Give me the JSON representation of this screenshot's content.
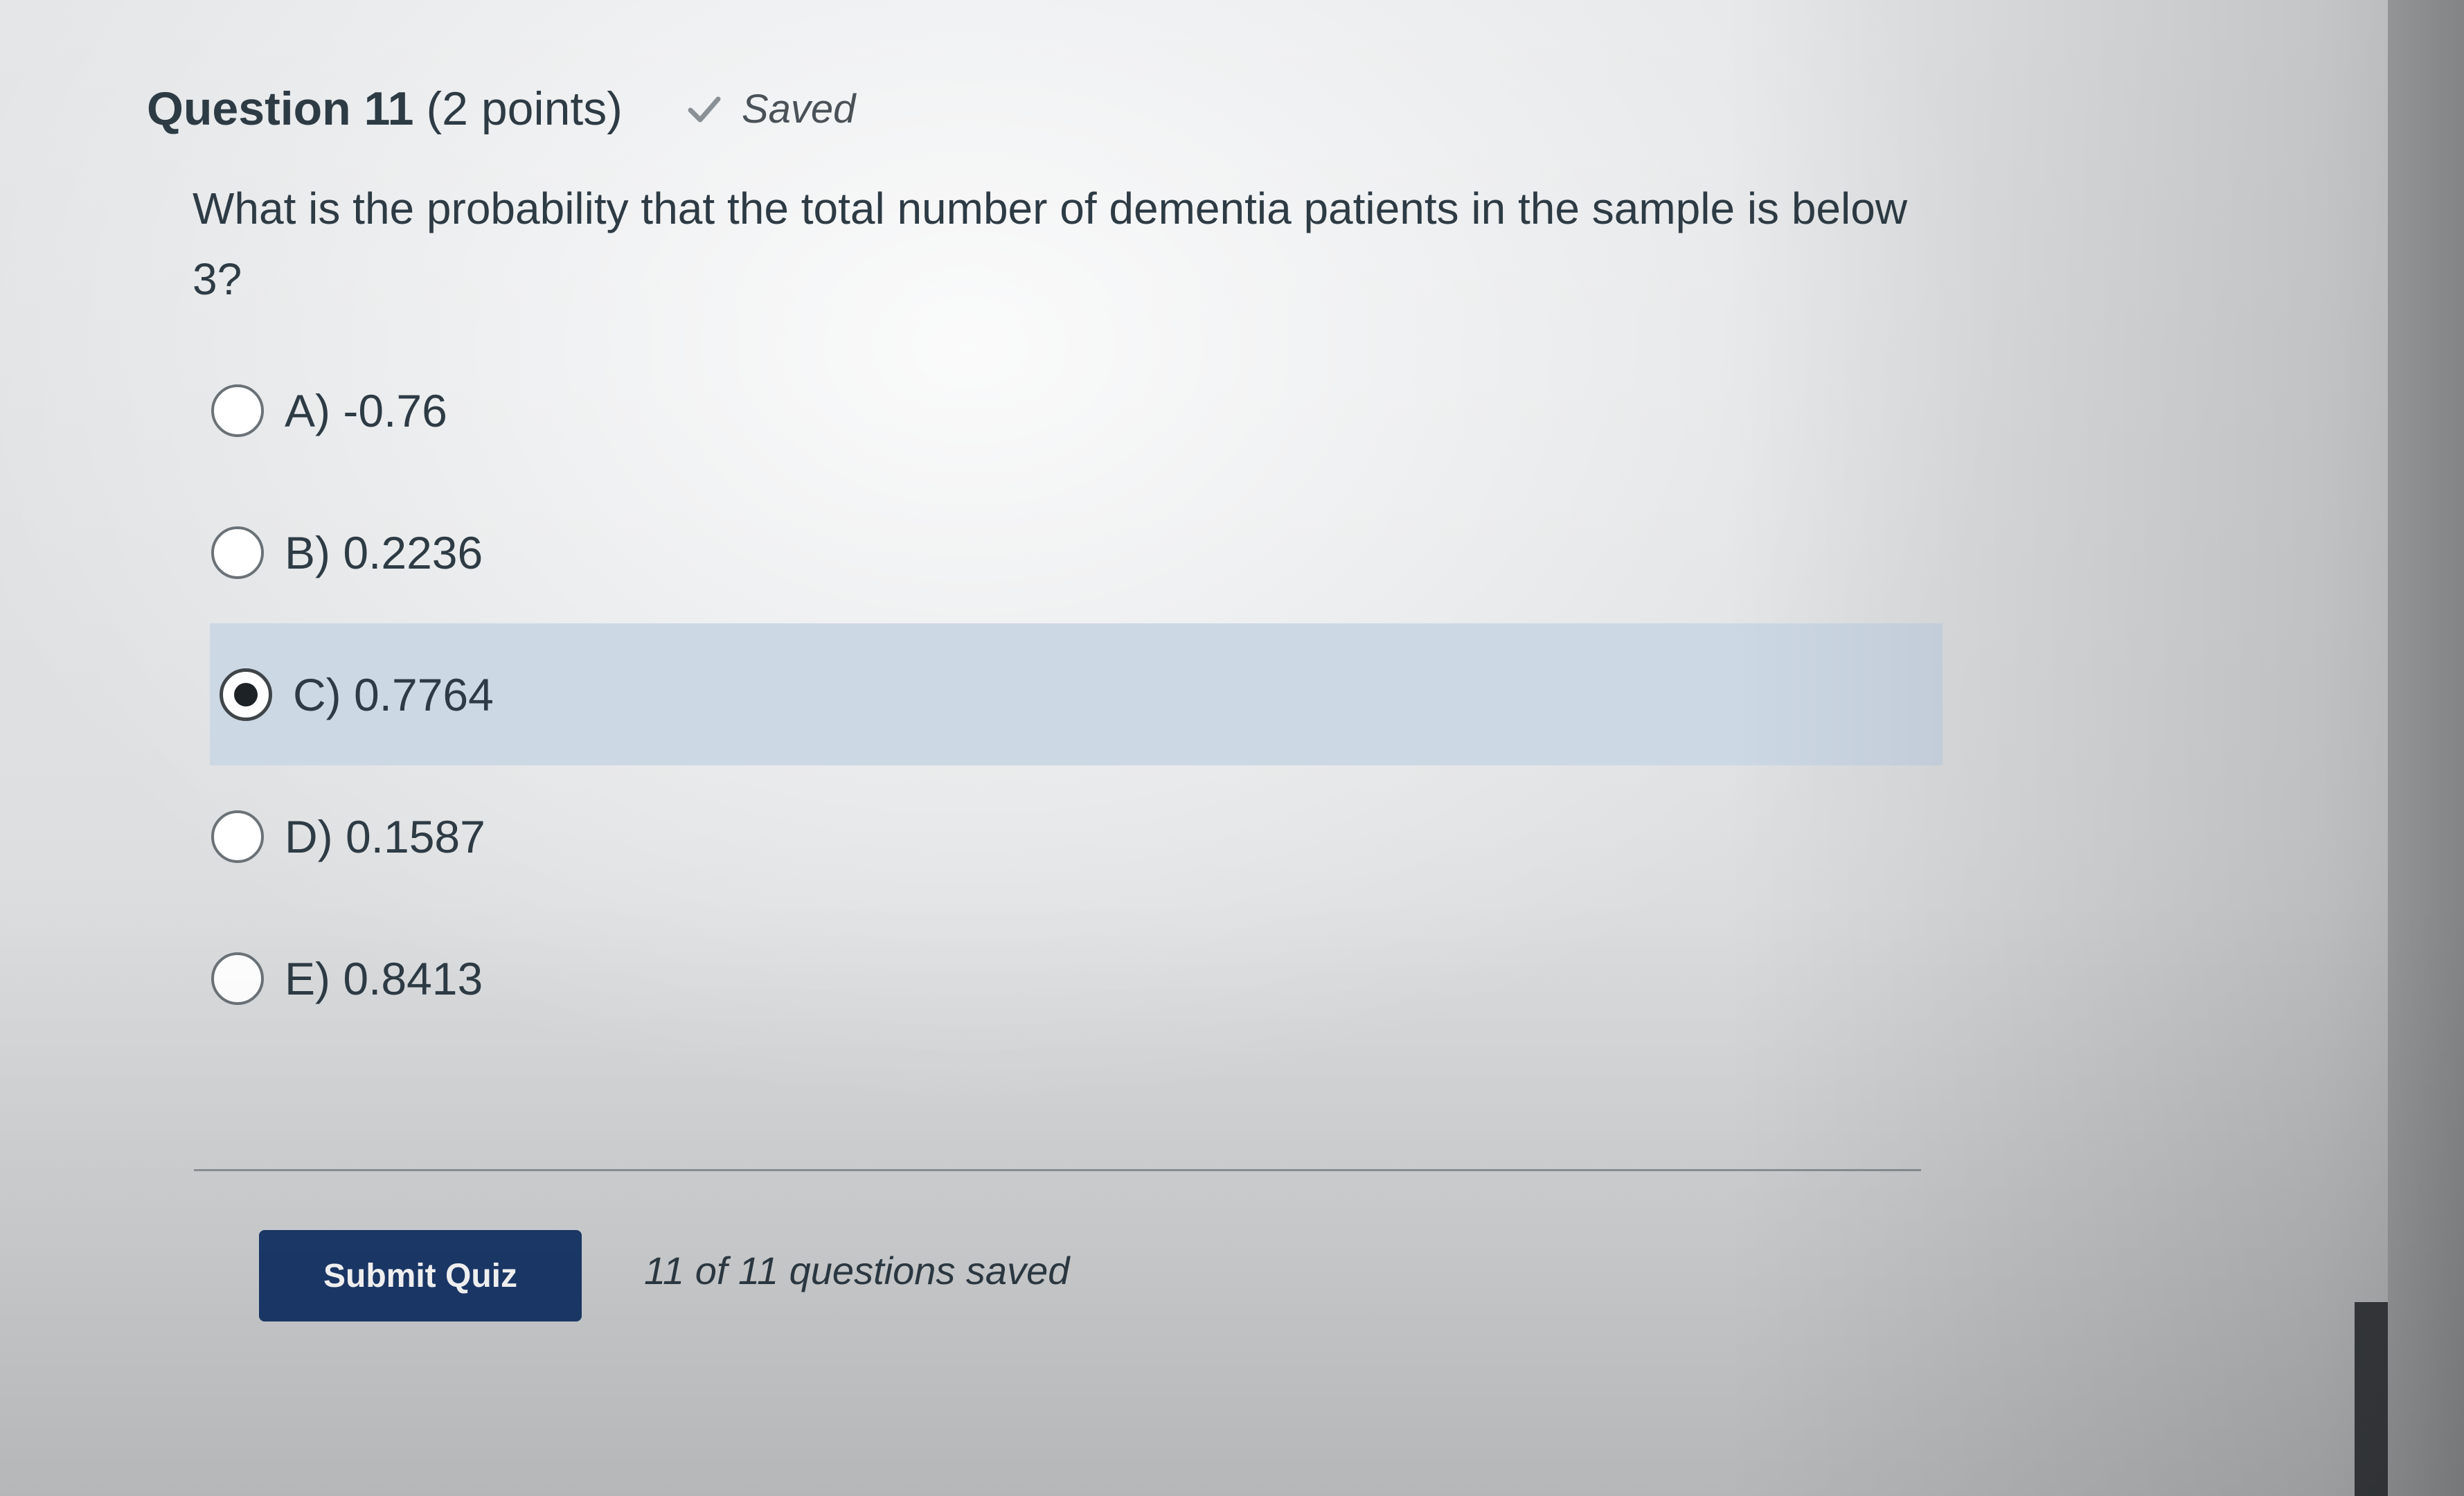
{
  "question": {
    "title": "Question 11",
    "points": "(2 points)",
    "status_icon": "checkmark-icon",
    "status_text": "Saved",
    "text": "What is the probability that the total number of dementia patients in the sample is below 3?"
  },
  "answers": [
    {
      "label": "A) -0.76",
      "selected": false
    },
    {
      "label": "B) 0.2236",
      "selected": false
    },
    {
      "label": "C) 0.7764",
      "selected": true
    },
    {
      "label": "D) 0.1587",
      "selected": false
    },
    {
      "label": "E) 0.8413",
      "selected": false
    }
  ],
  "footer": {
    "submit_label": "Submit Quiz",
    "saved_count_text": "11 of 11 questions saved"
  },
  "colors": {
    "submit_button": "#1c3a6b",
    "selected_answer_bg": "#cdd8e5",
    "text": "#2d3b45"
  }
}
